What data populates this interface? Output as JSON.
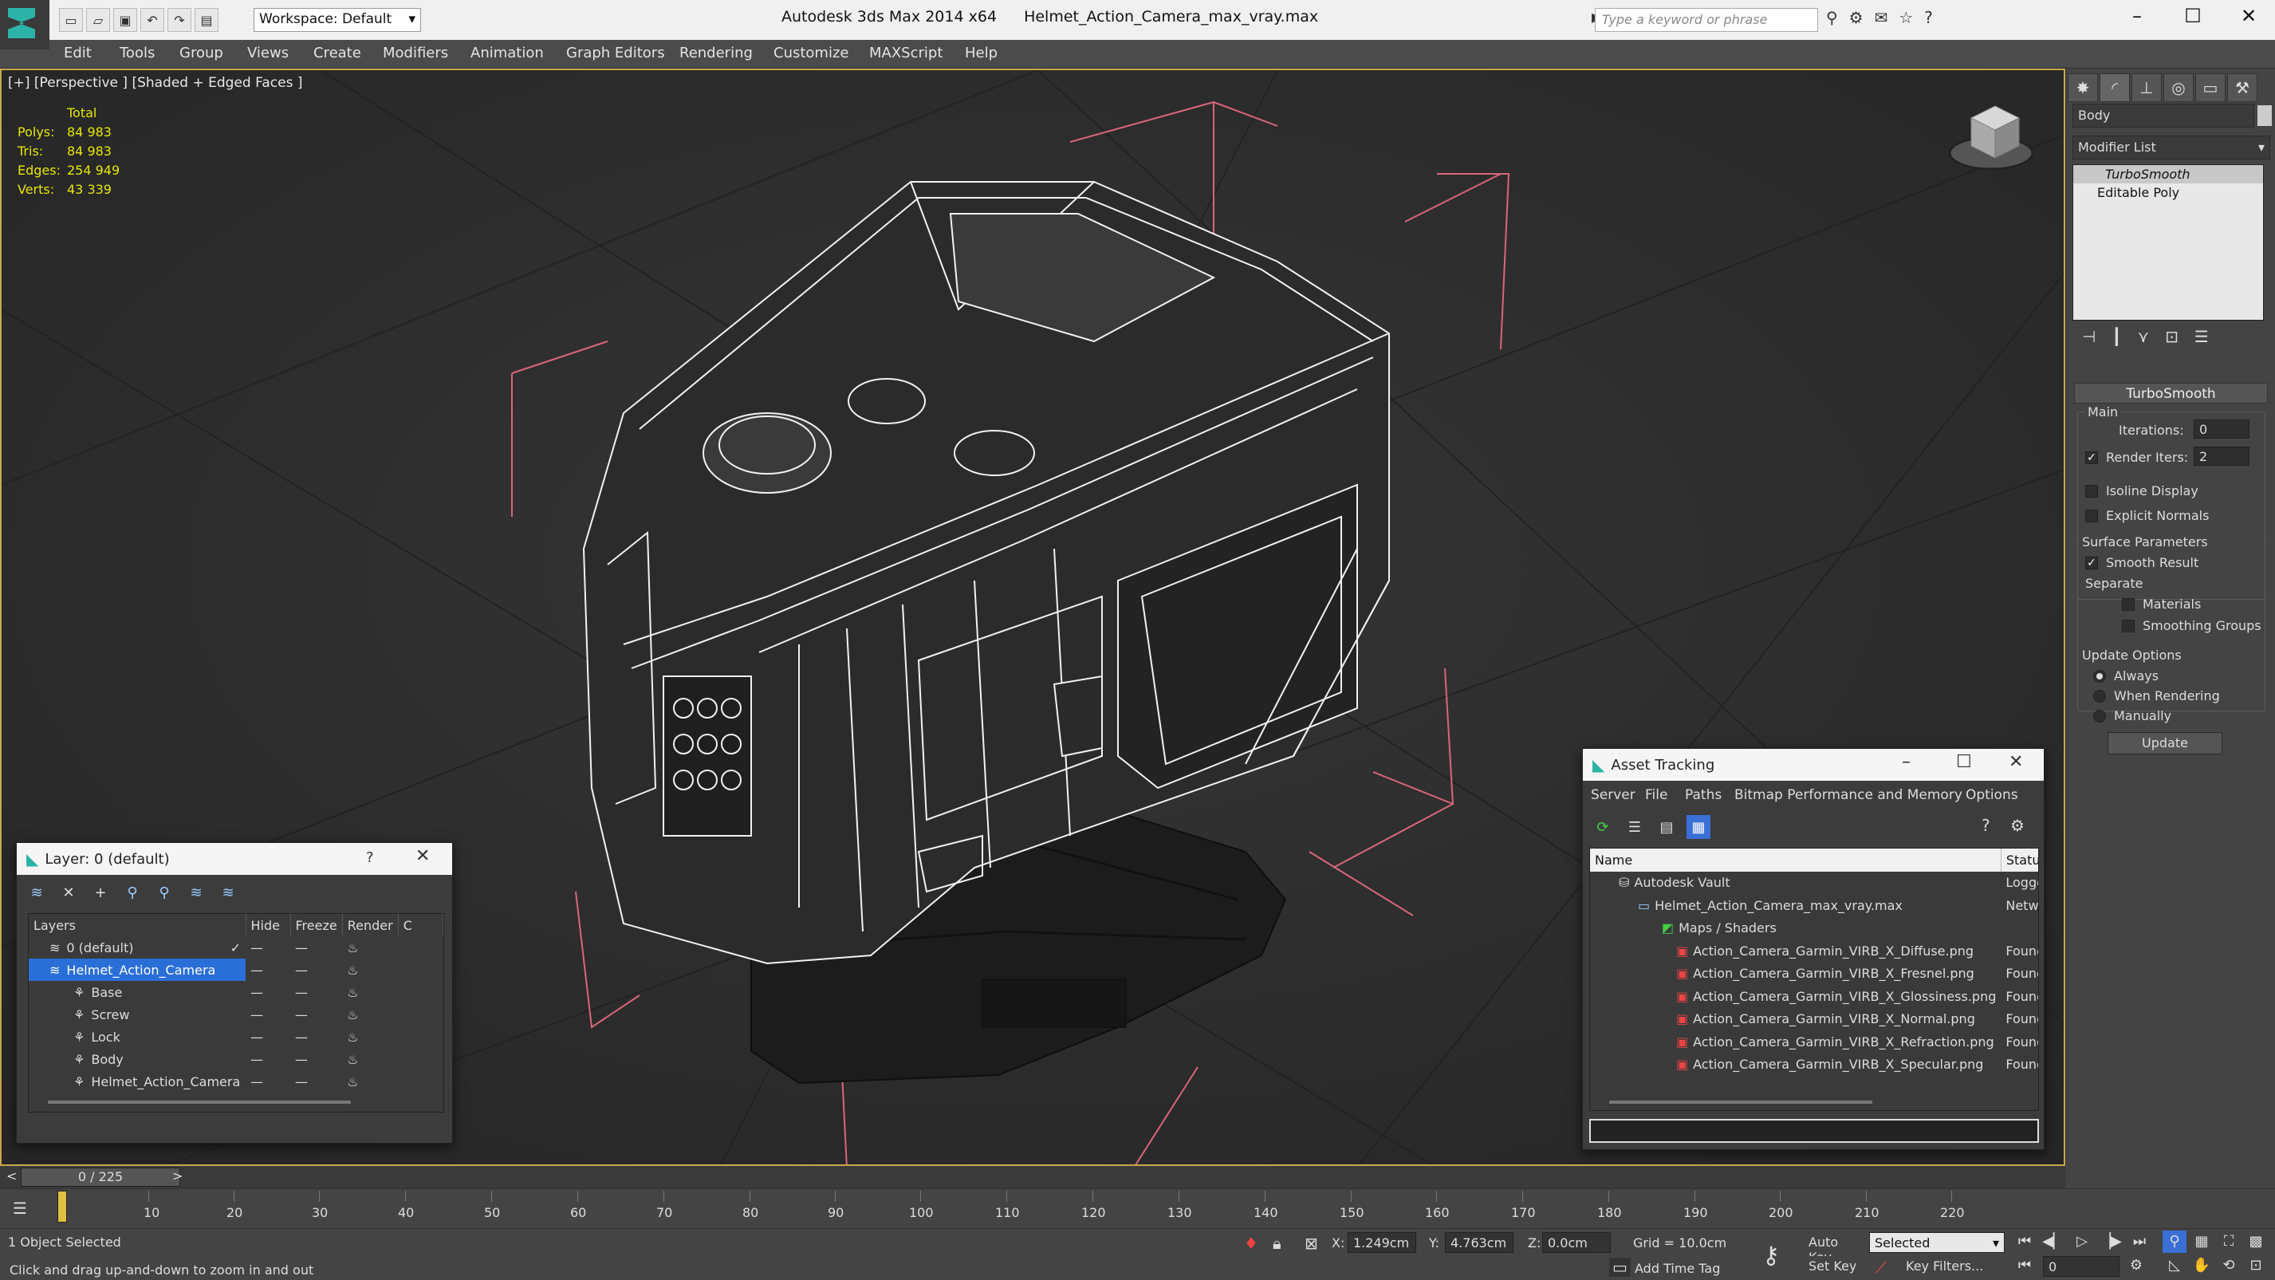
{
  "titlebar": {
    "workspace": "Workspace: Default",
    "app_title": "Autodesk 3ds Max  2014 x64",
    "file_title": "Helmet_Action_Camera_max_vray.max",
    "search_placeholder": "Type a keyword or phrase"
  },
  "menu": [
    "Edit",
    "Tools",
    "Group",
    "Views",
    "Create",
    "Modifiers",
    "Animation",
    "Graph Editors",
    "Rendering",
    "Customize",
    "MAXScript",
    "Help"
  ],
  "viewport": {
    "label": "[+] [Perspective ] [Shaded + Edged Faces ]",
    "stats_header": "Total",
    "stats": [
      {
        "label": "Polys:",
        "value": "84 983"
      },
      {
        "label": "Tris:",
        "value": "84 983"
      },
      {
        "label": "Edges:",
        "value": "254 949"
      },
      {
        "label": "Verts:",
        "value": "43 339"
      }
    ]
  },
  "command_panel": {
    "object_name": "Body",
    "modifier_list": "Modifier List",
    "stack": [
      "TurboSmooth",
      "Editable Poly"
    ],
    "rollout_title": "TurboSmooth",
    "main_group": "Main",
    "iterations_label": "Iterations:",
    "iterations_value": "0",
    "render_iters_label": "Render Iters:",
    "render_iters_value": "2",
    "isoline_label": "Isoline Display",
    "explicit_normals_label": "Explicit Normals",
    "surface_group": "Surface Parameters",
    "smooth_result_label": "Smooth Result",
    "separate_label": "Separate",
    "materials_label": "Materials",
    "smoothing_groups_label": "Smoothing Groups",
    "update_group": "Update Options",
    "always_label": "Always",
    "when_rendering_label": "When Rendering",
    "manually_label": "Manually",
    "update_button": "Update"
  },
  "layer_manager": {
    "title": "Layer: 0 (default)",
    "help": "?",
    "columns": [
      "Layers",
      "Hide",
      "Freeze",
      "Render",
      "C"
    ],
    "rows": [
      {
        "name": "0 (default)",
        "indent": 0
      },
      {
        "name": "Helmet_Action_Camera",
        "indent": 0,
        "selected": true
      },
      {
        "name": "Base",
        "indent": 1
      },
      {
        "name": "Screw",
        "indent": 1
      },
      {
        "name": "Lock",
        "indent": 1
      },
      {
        "name": "Body",
        "indent": 1
      },
      {
        "name": "Helmet_Action_Camera",
        "indent": 1
      }
    ]
  },
  "asset_tracking": {
    "title": "Asset Tracking",
    "menu": [
      "Server",
      "File",
      "Paths",
      "Bitmap Performance and Memory",
      "Options"
    ],
    "columns": [
      "Name",
      "Status"
    ],
    "rows": [
      {
        "name": "Autodesk Vault",
        "status": "Logge",
        "indent": 1
      },
      {
        "name": "Helmet_Action_Camera_max_vray.max",
        "status": "Netwo",
        "indent": 2
      },
      {
        "name": "Maps / Shaders",
        "status": "",
        "indent": 3
      },
      {
        "name": "Action_Camera_Garmin_VIRB_X_Diffuse.png",
        "status": "Found",
        "indent": 4
      },
      {
        "name": "Action_Camera_Garmin_VIRB_X_Fresnel.png",
        "status": "Found",
        "indent": 4
      },
      {
        "name": "Action_Camera_Garmin_VIRB_X_Glossiness.png",
        "status": "Found",
        "indent": 4
      },
      {
        "name": "Action_Camera_Garmin_VIRB_X_Normal.png",
        "status": "Found",
        "indent": 4
      },
      {
        "name": "Action_Camera_Garmin_VIRB_X_Refraction.png",
        "status": "Found",
        "indent": 4
      },
      {
        "name": "Action_Camera_Garmin_VIRB_X_Specular.png",
        "status": "Found",
        "indent": 4
      }
    ]
  },
  "timeline": {
    "frame_display": "0 / 225",
    "ticks": [
      "10",
      "20",
      "30",
      "40",
      "50",
      "60",
      "70",
      "80",
      "90",
      "100",
      "110",
      "120",
      "130",
      "140",
      "150",
      "160",
      "170",
      "180",
      "190",
      "200",
      "210",
      "220"
    ]
  },
  "statusbar": {
    "selection": "1 Object Selected",
    "prompt": "Click and drag up-and-down to zoom in and out",
    "x_label": "X:",
    "x_value": "1.249cm",
    "y_label": "Y:",
    "y_value": "4.763cm",
    "z_label": "Z:",
    "z_value": "0.0cm",
    "grid": "Grid = 10.0cm",
    "auto_key": "Auto Key",
    "set_key": "Set Key",
    "selected_dropdown": "Selected",
    "key_filters": "Key Filters...",
    "add_time_tag": "Add Time Tag",
    "current_frame": "0"
  }
}
